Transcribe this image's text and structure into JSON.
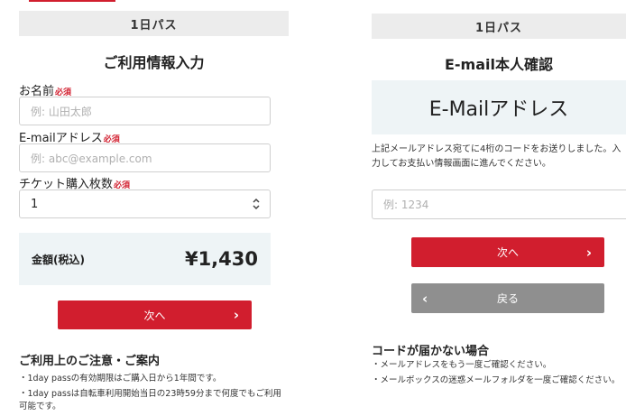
{
  "left": {
    "pass_title": "1日パス",
    "section_title": "ご利用情報入力",
    "name_label": "お名前",
    "required": "必須",
    "name_placeholder": "例: 山田太郎",
    "email_label": "E-mailアドレス",
    "email_placeholder": "例: abc@example.com",
    "ticket_label": "チケット購入枚数",
    "ticket_value": "1",
    "price_label": "金額(税込)",
    "price_value": "¥1,430",
    "next_label": "次へ",
    "notes_title": "ご利用上のご注意・ご案内",
    "notes": [
      "・1day passの有効期限はご購入日から1年間です。",
      "・1day passは自転車利用開始当日の23時59分まで何度でもご利用可能です。"
    ]
  },
  "right": {
    "pass_title": "1日パス",
    "section_title": "E-mail本人確認",
    "email_banner": "E-Mailアドレス",
    "instructions": "上記メールアドレス宛てに4桁のコードをお送りしました。入力してお支払い情報画面に進んでください。",
    "code_placeholder": "例: 1234",
    "next_label": "次へ",
    "back_label": "戻る",
    "notes_title": "コードが届かない場合",
    "notes": [
      "・メールアドレスをもう一度ご確認ください。",
      "・メールボックスの迷惑メールフォルダを一度ご確認ください。"
    ]
  },
  "colors": {
    "accent": "#d11e2e",
    "back_button": "#8f8f8f",
    "info_bg": "#eef4f6",
    "header_bg": "#ececec"
  },
  "icons": {
    "next": "chevron-right-icon",
    "back": "chevron-left-icon",
    "select": "select-arrows-icon"
  }
}
